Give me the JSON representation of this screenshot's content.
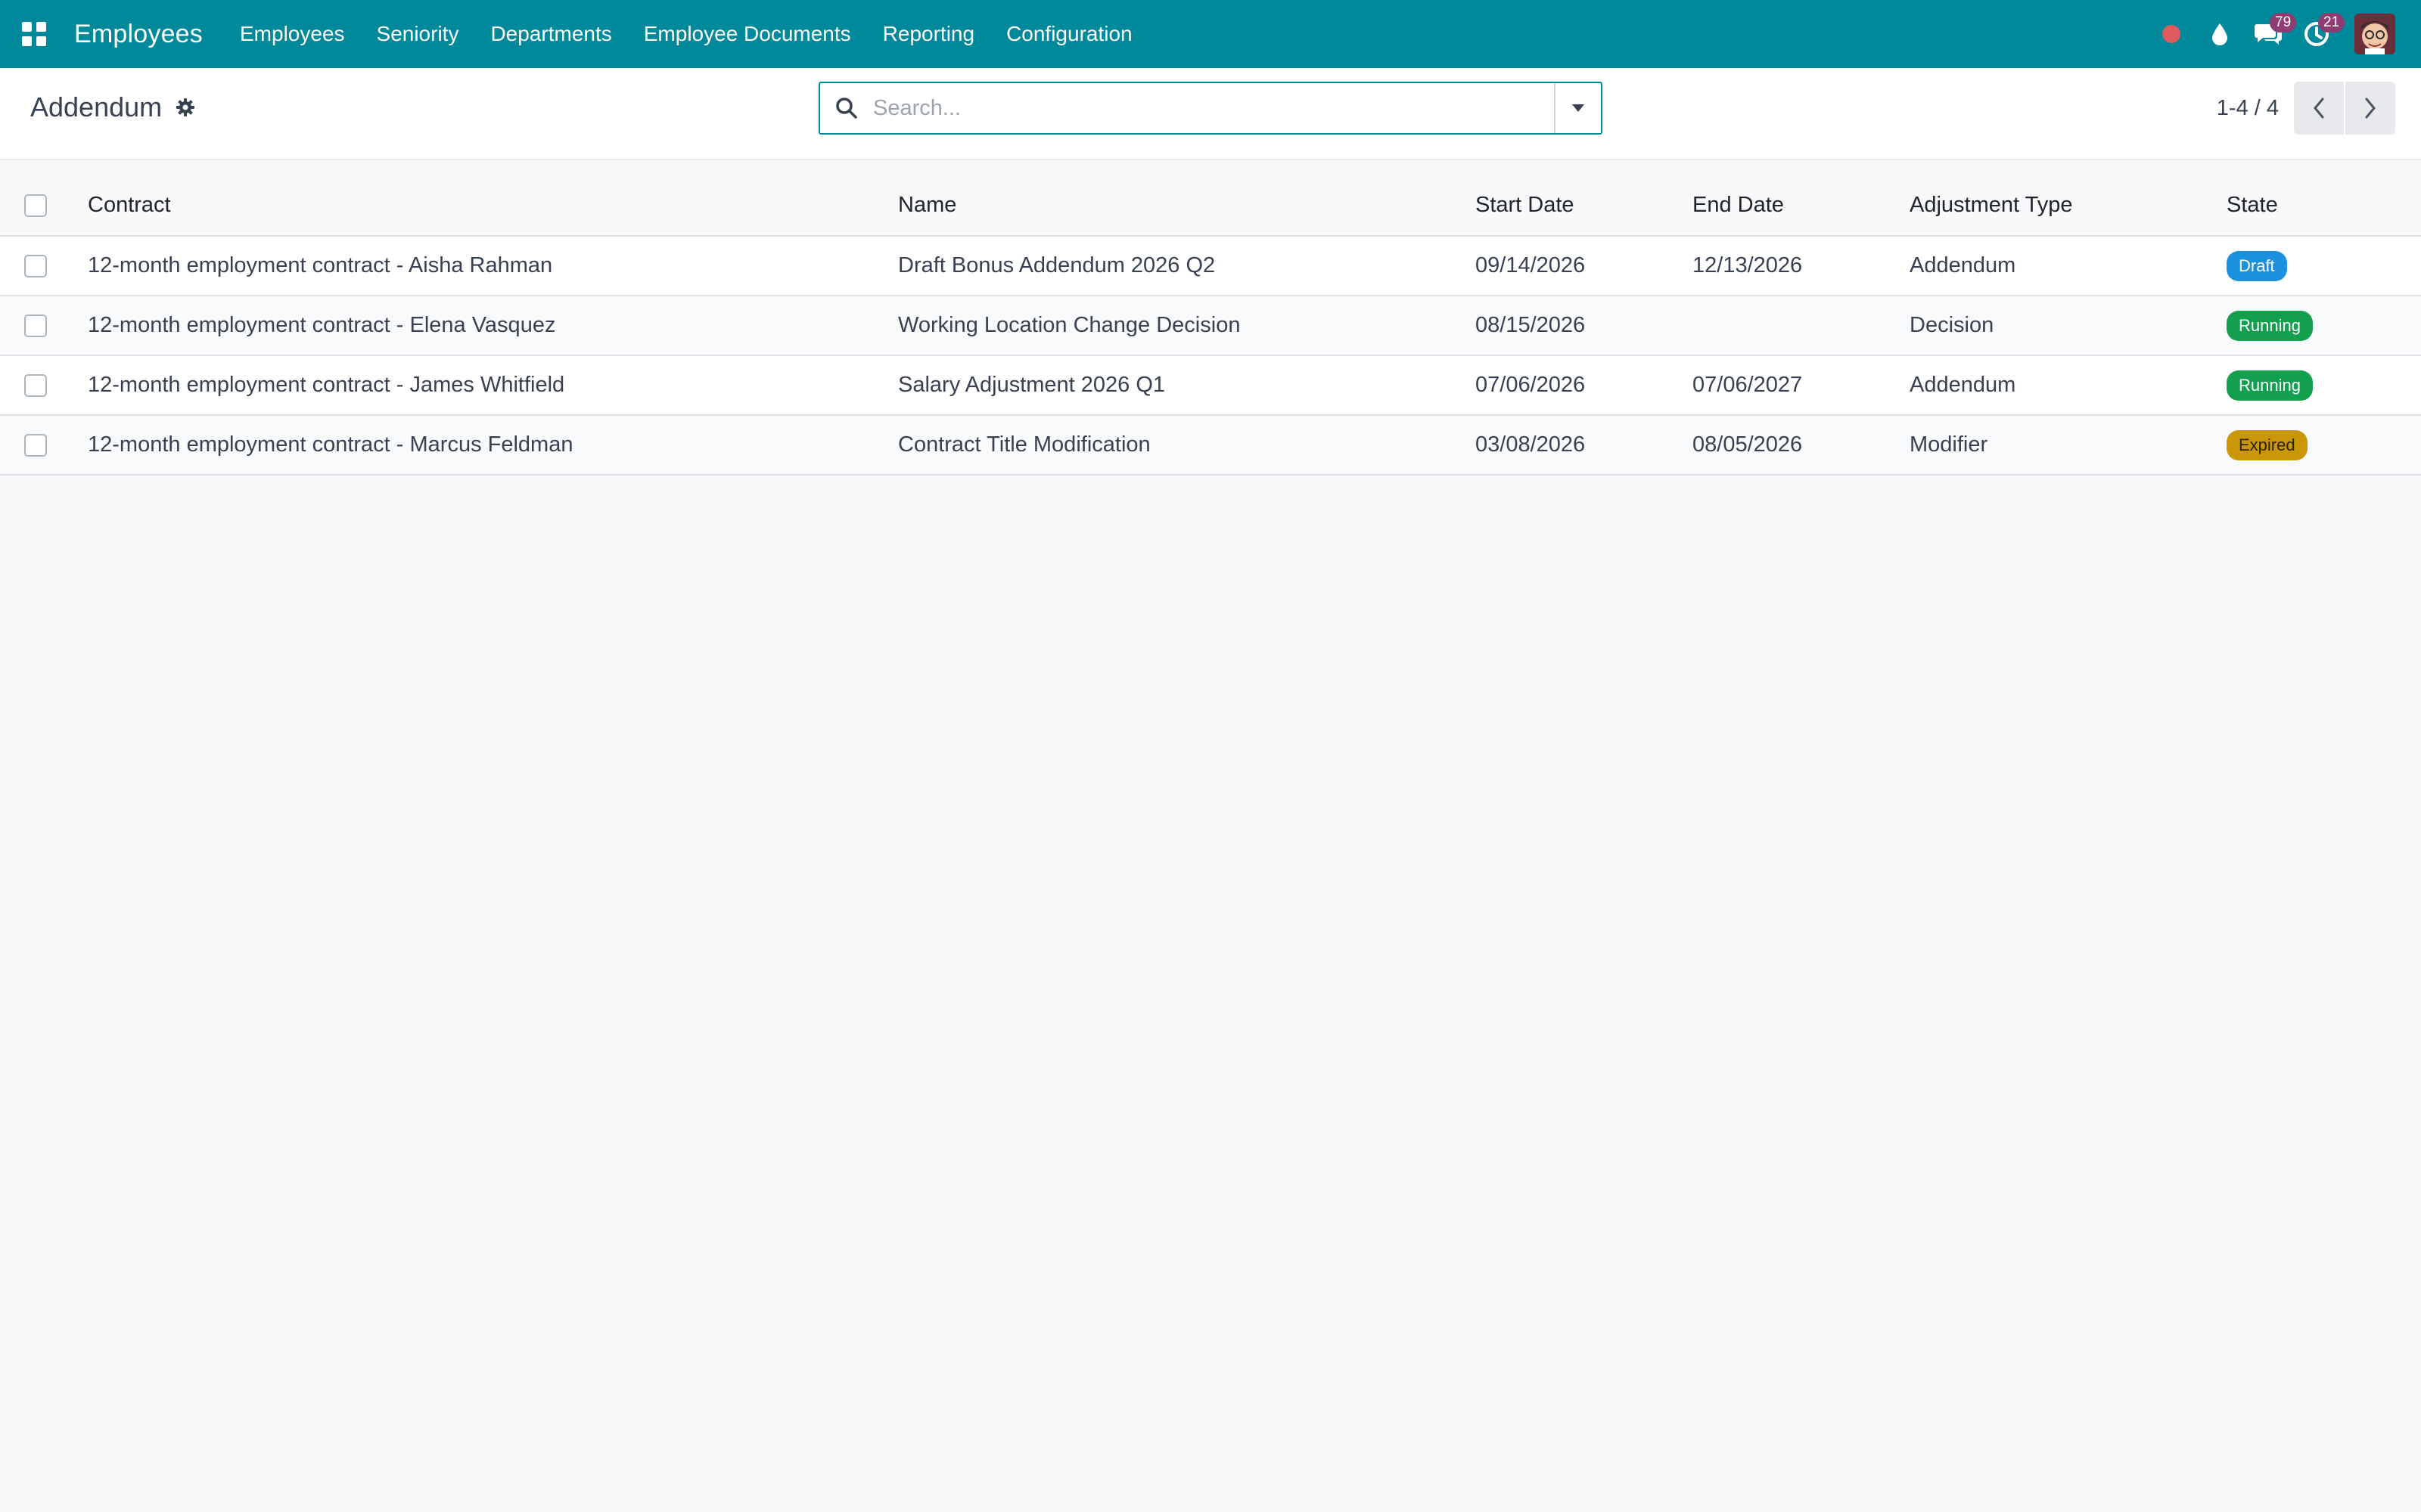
{
  "navbar": {
    "brand": "Employees",
    "menu": [
      "Employees",
      "Seniority",
      "Departments",
      "Employee Documents",
      "Reporting",
      "Configuration"
    ],
    "messages_count": "79",
    "activities_count": "21",
    "icons": [
      "apps-grid-icon",
      "record-dot-icon",
      "water-drop-icon",
      "chat-icon",
      "clock-icon",
      "avatar"
    ],
    "colors": {
      "bar": "#00899b",
      "badge": "#8f3c73",
      "record": "#e05c5c"
    }
  },
  "control_panel": {
    "title": "Addendum",
    "search_placeholder": "Search...",
    "pager": "1-4 / 4"
  },
  "table": {
    "columns": [
      "Contract",
      "Name",
      "Start Date",
      "End Date",
      "Adjustment Type",
      "State"
    ],
    "rows": [
      {
        "contract": "12-month employment contract - Aisha Rahman",
        "name": "Draft Bonus Addendum 2026 Q2",
        "start": "09/14/2026",
        "end": "12/13/2026",
        "type": "Addendum",
        "state": "Draft"
      },
      {
        "contract": "12-month employment contract - Elena Vasquez",
        "name": "Working Location Change Decision",
        "start": "08/15/2026",
        "end": "",
        "type": "Decision",
        "state": "Running"
      },
      {
        "contract": "12-month employment contract - James Whitfield",
        "name": "Salary Adjustment 2026 Q1",
        "start": "07/06/2026",
        "end": "07/06/2027",
        "type": "Addendum",
        "state": "Running"
      },
      {
        "contract": "12-month employment contract - Marcus Feldman",
        "name": "Contract Title Modification",
        "start": "03/08/2026",
        "end": "08/05/2026",
        "type": "Modifier",
        "state": "Expired"
      }
    ],
    "state_colors": {
      "Draft": "#1b91de",
      "Running": "#12a04f",
      "Expired": "#c99708"
    }
  }
}
